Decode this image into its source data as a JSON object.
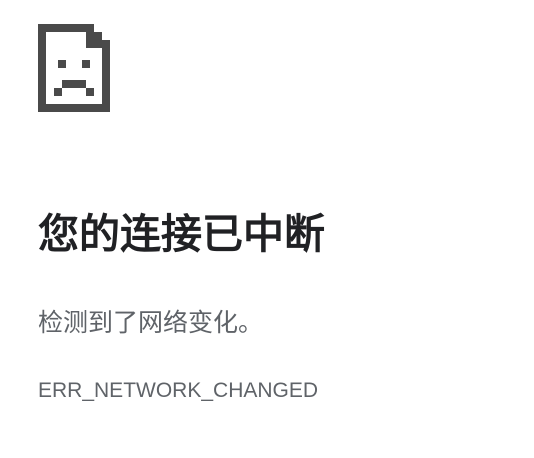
{
  "error_page": {
    "icon": "sad-page-icon",
    "title": "您的连接已中断",
    "message": "检测到了网络变化。",
    "error_code": "ERR_NETWORK_CHANGED"
  },
  "colors": {
    "icon": "#4a4a4a",
    "title": "#202124",
    "message": "#5f6368",
    "background": "#ffffff"
  }
}
